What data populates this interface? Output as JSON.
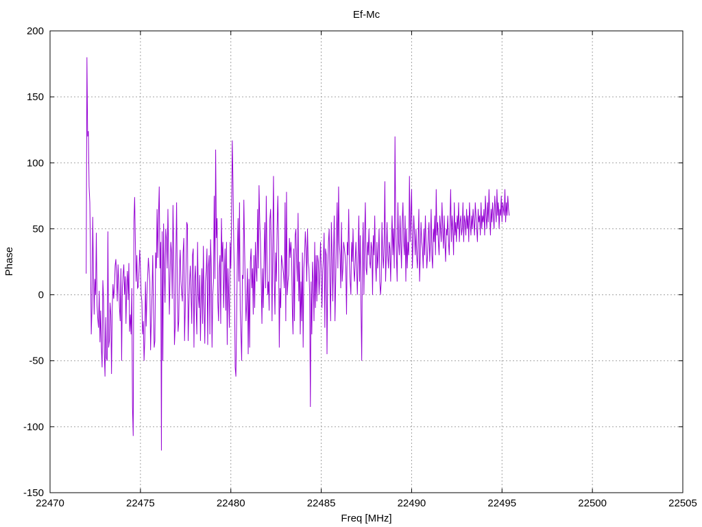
{
  "chart_data": {
    "type": "line",
    "title": "Ef-Mc",
    "xlabel": "Freq [MHz]",
    "ylabel": "Phase",
    "xlim": [
      22470,
      22505
    ],
    "ylim": [
      -150,
      200
    ],
    "xticks": [
      22470,
      22475,
      22480,
      22485,
      22490,
      22495,
      22500,
      22505
    ],
    "yticks": [
      -150,
      -100,
      -50,
      0,
      50,
      100,
      150,
      200
    ],
    "grid": true,
    "legend": "none",
    "series": [
      {
        "color": "#9400d3",
        "x_start": 22472.0,
        "x_step": 0.04,
        "values": [
          16,
          180,
          120,
          124,
          82,
          70,
          28,
          -30,
          -10,
          59,
          18,
          -15,
          12,
          0,
          47,
          -8,
          -18,
          -25,
          3,
          -36,
          -12,
          -40,
          -55,
          11,
          -2,
          -44,
          -62,
          -17,
          -48,
          -50,
          48,
          -40,
          -35,
          -6,
          -15,
          -60,
          -10,
          8,
          -3,
          5,
          22,
          27,
          14,
          -5,
          23,
          10,
          -10,
          -20,
          20,
          -50,
          5,
          15,
          23,
          0,
          14,
          -22,
          7,
          18,
          -4,
          24,
          -28,
          -15,
          -30,
          5,
          -85,
          -107,
          56,
          74,
          40,
          10,
          30,
          5,
          6,
          18,
          34,
          20,
          0,
          -5,
          -30,
          -20,
          -50,
          -34,
          10,
          -24,
          0,
          14,
          28,
          18,
          10,
          -42,
          -20,
          0,
          30,
          -10,
          -40,
          -35,
          32,
          20,
          65,
          28,
          60,
          82,
          20,
          40,
          -118,
          48,
          -50,
          54,
          18,
          -6,
          50,
          42,
          20,
          65,
          30,
          -15,
          15,
          40,
          32,
          -3,
          68,
          35,
          -38,
          -25,
          28,
          70,
          10,
          -28,
          -20,
          20,
          34,
          10,
          2,
          -5,
          32,
          43,
          -35,
          -10,
          20,
          55,
          53,
          -35,
          -10,
          10,
          22,
          0,
          -22,
          30,
          35,
          -40,
          10,
          22,
          -10,
          -30,
          40,
          0,
          -10,
          15,
          -35,
          -3,
          20,
          -22,
          37,
          -7,
          -37,
          10,
          18,
          35,
          -38,
          21,
          30,
          -30,
          42,
          20,
          -40,
          0,
          10,
          75,
          12,
          110,
          43,
          58,
          -5,
          -20,
          20,
          30,
          -22,
          58,
          25,
          40,
          -10,
          15,
          35,
          -12,
          40,
          -38,
          20,
          0,
          -25,
          40,
          20,
          55,
          117,
          85,
          40,
          10,
          -55,
          -62,
          -20,
          30,
          58,
          10,
          70,
          -12,
          -30,
          -50,
          15,
          12,
          72,
          36,
          5,
          -20,
          -5,
          20,
          -45,
          12,
          -40,
          25,
          35,
          5,
          20,
          -15,
          30,
          -10,
          40,
          20,
          10,
          65,
          20,
          83,
          55,
          40,
          10,
          -22,
          20,
          -10,
          30,
          55,
          5,
          75,
          30,
          0,
          10,
          -12,
          57,
          65,
          35,
          -20,
          40,
          90,
          12,
          -15,
          32,
          10,
          50,
          75,
          40,
          -40,
          5,
          -10,
          30,
          25,
          20,
          15,
          5,
          70,
          -20,
          78,
          0,
          10,
          15,
          43,
          28,
          40,
          30,
          -10,
          -30,
          35,
          -20,
          45,
          50,
          25,
          10,
          62,
          -5,
          25,
          -30,
          10,
          -20,
          32,
          -40,
          20,
          30,
          48,
          35,
          10,
          50,
          25,
          20,
          0,
          -85,
          10,
          -30,
          25,
          10,
          -20,
          40,
          -10,
          30,
          -5,
          30,
          25,
          0,
          15,
          40,
          20,
          -10,
          18,
          28,
          47,
          -25,
          35,
          30,
          -45,
          20,
          40,
          50,
          10,
          -20,
          55,
          30,
          -5,
          30,
          60,
          -20,
          10,
          43,
          70,
          20,
          82,
          40,
          30,
          5,
          55,
          10,
          20,
          40,
          35,
          30,
          20,
          -15,
          40,
          30,
          65,
          25,
          10,
          0,
          40,
          25,
          50,
          20,
          10,
          25,
          40,
          20,
          0,
          30,
          60,
          10,
          45,
          -10,
          -50,
          30,
          55,
          0,
          45,
          70,
          20,
          15,
          40,
          30,
          50,
          25,
          20,
          40,
          35,
          0,
          45,
          30,
          60,
          25,
          10,
          40,
          20,
          30,
          50,
          10,
          0,
          10,
          55,
          30,
          20,
          40,
          86,
          10,
          30,
          55,
          30,
          20,
          40,
          35,
          10,
          40,
          60,
          30,
          50,
          20,
          120,
          50,
          30,
          10,
          70,
          40,
          30,
          60,
          40,
          20,
          55,
          70,
          40,
          30,
          60,
          10,
          50,
          20,
          40,
          30,
          90,
          40,
          60,
          80,
          20,
          40,
          60,
          45,
          30,
          50,
          30,
          20,
          40,
          65,
          10,
          30,
          55,
          40,
          35,
          20,
          50,
          30,
          60,
          40,
          20,
          30,
          45,
          55,
          25,
          40,
          65,
          30,
          20,
          50,
          40,
          60,
          30,
          80,
          45,
          55,
          40,
          30,
          60,
          50,
          40,
          70,
          50,
          35,
          60,
          40,
          25,
          50,
          45,
          60,
          40,
          30,
          55,
          80,
          40,
          60,
          50,
          30,
          70,
          45,
          55,
          40,
          60,
          50,
          70,
          40,
          55,
          60,
          45,
          50,
          70,
          40,
          60,
          55,
          45,
          65,
          50,
          60,
          40,
          70,
          55,
          45,
          60,
          50,
          65,
          55,
          45,
          70,
          60,
          50,
          40,
          65,
          55,
          60,
          45,
          70,
          50,
          60,
          55,
          65,
          45,
          75,
          60,
          50,
          70,
          55,
          80,
          60,
          45,
          65,
          55,
          70,
          60,
          50,
          75,
          65,
          55,
          80,
          60,
          70,
          50,
          65,
          60,
          75,
          55,
          70,
          65,
          60,
          80,
          55,
          70,
          60,
          75,
          65,
          60
        ]
      }
    ]
  }
}
